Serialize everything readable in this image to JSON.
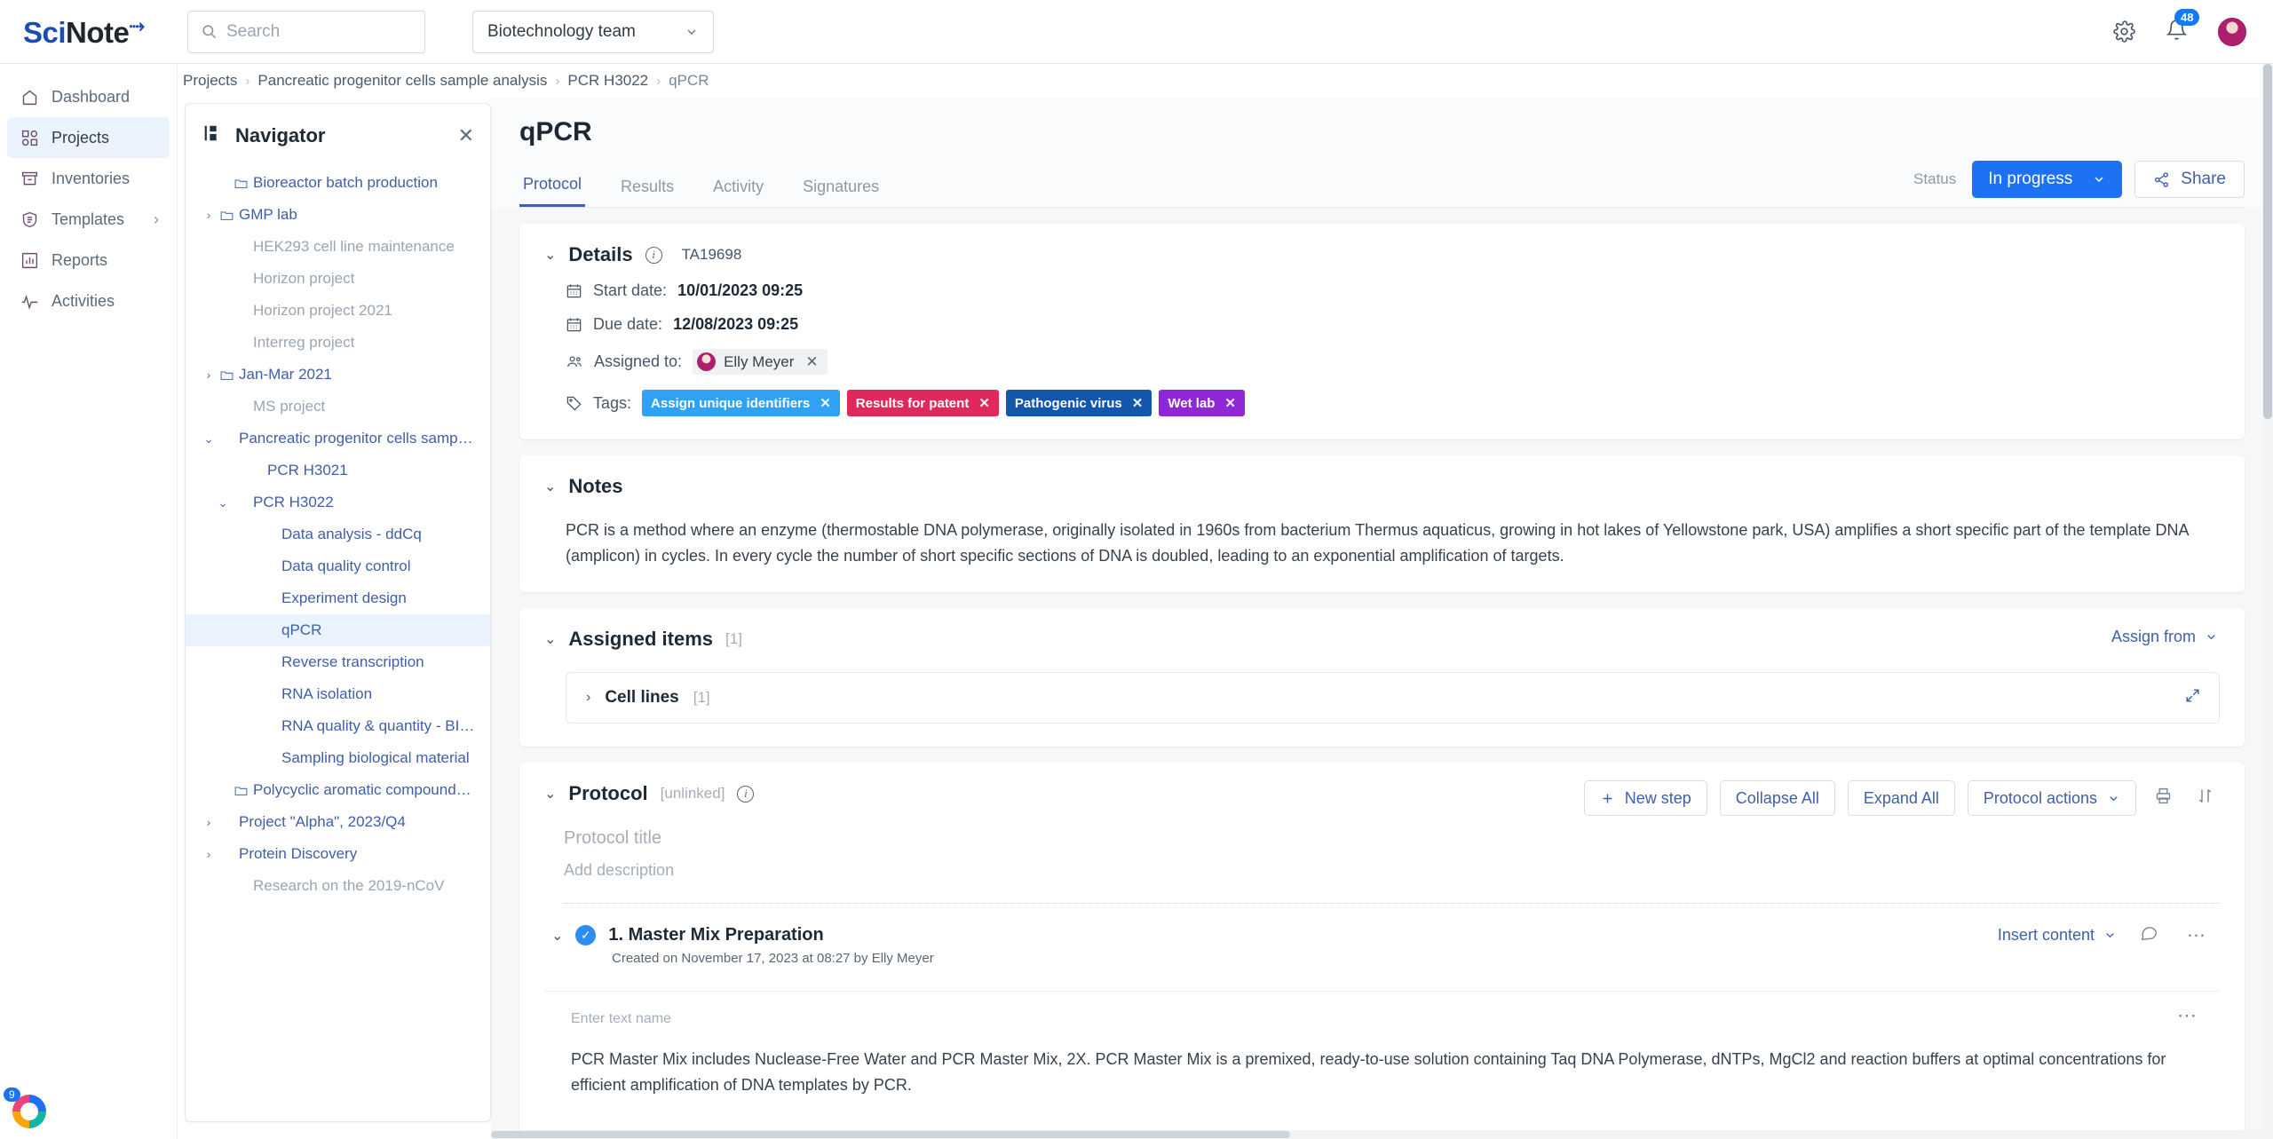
{
  "brand": {
    "sci": "Sci",
    "note": "Note",
    "tick": "↘"
  },
  "search": {
    "placeholder": "Search"
  },
  "team": {
    "selected": "Biotechnology team"
  },
  "topbar": {
    "settings_icon": "gear-icon",
    "notifications_icon": "bell-icon",
    "notification_count": "48",
    "avatar": "user-avatar"
  },
  "sidebar": {
    "items": [
      {
        "label": "Dashboard",
        "icon": "home-icon",
        "active": false,
        "chevron": false
      },
      {
        "label": "Projects",
        "icon": "grid-icon",
        "active": true,
        "chevron": false
      },
      {
        "label": "Inventories",
        "icon": "archive-icon",
        "active": false,
        "chevron": false
      },
      {
        "label": "Templates",
        "icon": "shield-icon",
        "active": false,
        "chevron": true
      },
      {
        "label": "Reports",
        "icon": "chart-icon",
        "active": false,
        "chevron": false
      },
      {
        "label": "Activities",
        "icon": "pulse-icon",
        "active": false,
        "chevron": false
      }
    ]
  },
  "breadcrumb": {
    "items": [
      "Projects",
      "Pancreatic progenitor cells sample analysis",
      "PCR H3022",
      "qPCR"
    ]
  },
  "navigator": {
    "title": "Navigator",
    "icon": "panel-icon",
    "close_icon": "close-icon",
    "tree": [
      {
        "label": "Bioreactor batch production",
        "indent": 1,
        "twisty": "",
        "folder": true,
        "style": "link"
      },
      {
        "label": "GMP lab",
        "indent": 0,
        "twisty": "›",
        "folder": true,
        "style": "link"
      },
      {
        "label": "HEK293 cell line maintenance",
        "indent": 1,
        "twisty": "",
        "folder": false,
        "style": "muted"
      },
      {
        "label": "Horizon project",
        "indent": 1,
        "twisty": "",
        "folder": false,
        "style": "muted"
      },
      {
        "label": "Horizon project 2021",
        "indent": 1,
        "twisty": "",
        "folder": false,
        "style": "muted"
      },
      {
        "label": "Interreg project",
        "indent": 1,
        "twisty": "",
        "folder": false,
        "style": "muted"
      },
      {
        "label": "Jan-Mar 2021",
        "indent": 0,
        "twisty": "›",
        "folder": true,
        "style": "link"
      },
      {
        "label": "MS project",
        "indent": 1,
        "twisty": "",
        "folder": false,
        "style": "muted"
      },
      {
        "label": "Pancreatic progenitor cells sample anal...",
        "indent": 0,
        "twisty": "⌄",
        "folder": false,
        "style": "link"
      },
      {
        "label": "PCR H3021",
        "indent": 2,
        "twisty": "",
        "folder": false,
        "style": "link"
      },
      {
        "label": "PCR H3022",
        "indent": 1,
        "twisty": "⌄",
        "folder": false,
        "style": "link"
      },
      {
        "label": "Data analysis - ddCq",
        "indent": 3,
        "twisty": "",
        "folder": false,
        "style": "link"
      },
      {
        "label": "Data quality control",
        "indent": 3,
        "twisty": "",
        "folder": false,
        "style": "link"
      },
      {
        "label": "Experiment design",
        "indent": 3,
        "twisty": "",
        "folder": false,
        "style": "link"
      },
      {
        "label": "qPCR",
        "indent": 3,
        "twisty": "",
        "folder": false,
        "style": "link",
        "selected": true
      },
      {
        "label": "Reverse transcription",
        "indent": 3,
        "twisty": "",
        "folder": false,
        "style": "link"
      },
      {
        "label": "RNA isolation",
        "indent": 3,
        "twisty": "",
        "folder": false,
        "style": "link"
      },
      {
        "label": "RNA quality & quantity - BIOANA...",
        "indent": 3,
        "twisty": "",
        "folder": false,
        "style": "link"
      },
      {
        "label": "Sampling biological material",
        "indent": 3,
        "twisty": "",
        "folder": false,
        "style": "link"
      },
      {
        "label": "Polycyclic aromatic compounds (PA...",
        "indent": 1,
        "twisty": "",
        "folder": true,
        "style": "link"
      },
      {
        "label": "Project \"Alpha\", 2023/Q4",
        "indent": 0,
        "twisty": "›",
        "folder": false,
        "style": "link"
      },
      {
        "label": "Protein Discovery",
        "indent": 0,
        "twisty": "›",
        "folder": false,
        "style": "link"
      },
      {
        "label": "Research on the 2019-nCoV",
        "indent": 1,
        "twisty": "",
        "folder": false,
        "style": "muted"
      }
    ]
  },
  "page": {
    "title": "qPCR",
    "tabs": [
      {
        "label": "Protocol",
        "active": true
      },
      {
        "label": "Results",
        "active": false
      },
      {
        "label": "Activity",
        "active": false
      },
      {
        "label": "Signatures",
        "active": false
      }
    ],
    "status_label": "Status",
    "status_value": "In progress",
    "share_label": "Share",
    "share_icon": "share-icon"
  },
  "details": {
    "title": "Details",
    "info_icon": "info-icon",
    "code": "TA19698",
    "start_date_label": "Start date:",
    "start_date_value": "10/01/2023 09:25",
    "due_date_label": "Due date:",
    "due_date_value": "12/08/2023 09:25",
    "assigned_label": "Assigned to:",
    "assignee": "Elly Meyer",
    "tags_label": "Tags:",
    "tags": [
      {
        "label": "Assign unique identifiers",
        "color": "#30a1f5"
      },
      {
        "label": "Results for patent",
        "color": "#e0285c"
      },
      {
        "label": "Pathogenic virus",
        "color": "#1257ad"
      },
      {
        "label": "Wet lab",
        "color": "#8e27d6"
      }
    ]
  },
  "notes": {
    "title": "Notes",
    "body": "PCR is a method where an enzyme (thermostable DNA polymerase, originally isolated in 1960s from bacterium Thermus aquaticus, growing in hot lakes of Yellowstone park, USA) amplifies a short specific part of the template DNA (amplicon) in cycles. In every cycle the number of short specific sections of DNA is doubled, leading to an exponential amplification of targets."
  },
  "assigned_items": {
    "title": "Assigned items",
    "count": "[1]",
    "assign_from": "Assign from",
    "rows": [
      {
        "label": "Cell lines",
        "count": "[1]",
        "expand_icon": "expand-icon"
      }
    ]
  },
  "protocol": {
    "title": "Protocol",
    "state": "[unlinked]",
    "info_icon": "info-icon",
    "buttons": {
      "new_step": "New step",
      "collapse_all": "Collapse All",
      "expand_all": "Expand All",
      "protocol_actions": "Protocol actions",
      "print_icon": "print-icon",
      "sort_icon": "sort-icon"
    },
    "title_placeholder": "Protocol title",
    "description_placeholder": "Add description",
    "steps": [
      {
        "title": "1. Master Mix Preparation",
        "meta": "Created on November 17, 2023 at 08:27 by Elly Meyer",
        "insert_label": "Insert content",
        "comment_icon": "comment-icon",
        "more_icon": "more-icon",
        "text_name_placeholder": "Enter text name",
        "body": "PCR Master Mix includes Nuclease-Free Water and PCR Master Mix, 2X. PCR Master Mix is a premixed, ready-to-use solution containing Taq DNA Polymerase, dNTPs, MgCl2 and reaction buffers at optimal concentrations for efficient amplification of DNA templates by PCR.",
        "kebab_icon": "kebab-icon"
      }
    ]
  },
  "help": {
    "badge": "9",
    "icon": "help-widget-icon"
  }
}
